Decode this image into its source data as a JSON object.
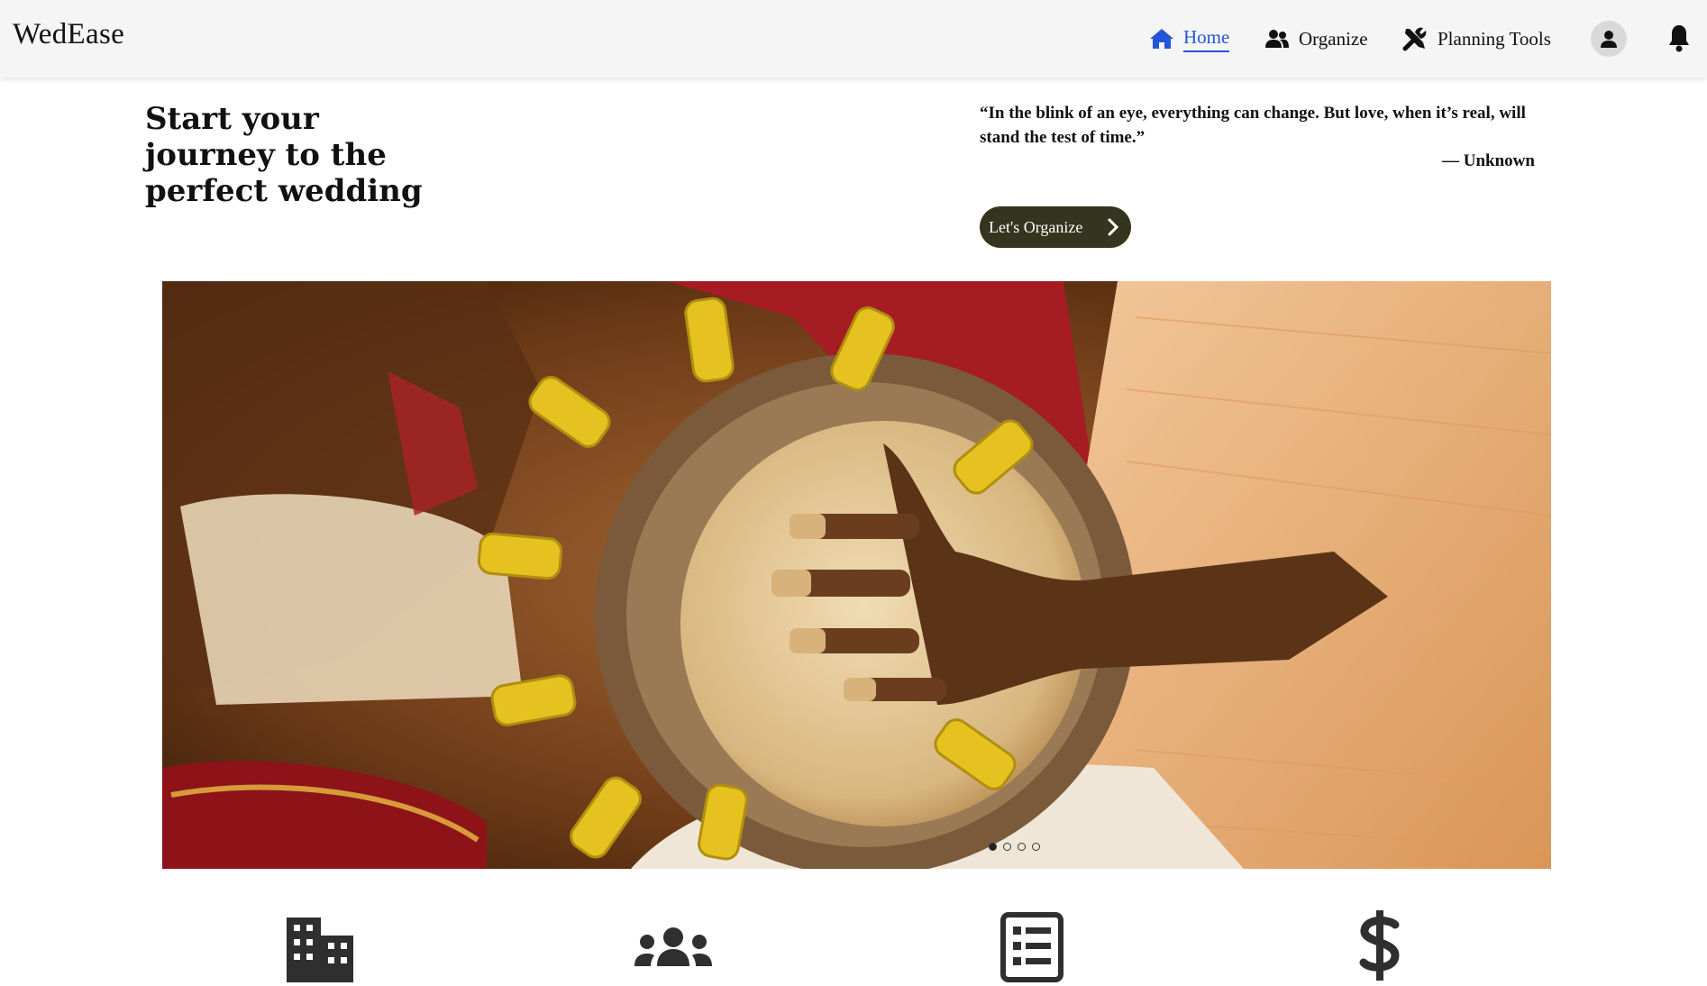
{
  "header": {
    "brand": "WedEase",
    "nav": [
      {
        "label": "Home",
        "icon": "home-icon",
        "active": true
      },
      {
        "label": "Organize",
        "icon": "users-icon"
      },
      {
        "label": "Planning Tools",
        "icon": "tools-icon"
      }
    ],
    "profile_icon": "user-icon",
    "notifications_icon": "bell-icon",
    "colors": {
      "active": "#2356d6",
      "background": "#f5f5f5"
    }
  },
  "hero": {
    "title": "Start your journey to the perfect wedding",
    "quote": "“In the blink of an eye, everything can change. But love, when it’s real, will stand the test of time.”",
    "quote_author": "— Unknown",
    "cta_label": "Let's Organize",
    "cta_color": "#35351f"
  },
  "carousel": {
    "slide_count": 4,
    "active_index": 0,
    "image_subject": "musician playing a drum with yellow rings"
  },
  "features": [
    {
      "icon": "building-icon"
    },
    {
      "icon": "group-icon"
    },
    {
      "icon": "list-icon"
    },
    {
      "icon": "dollar-icon"
    }
  ]
}
